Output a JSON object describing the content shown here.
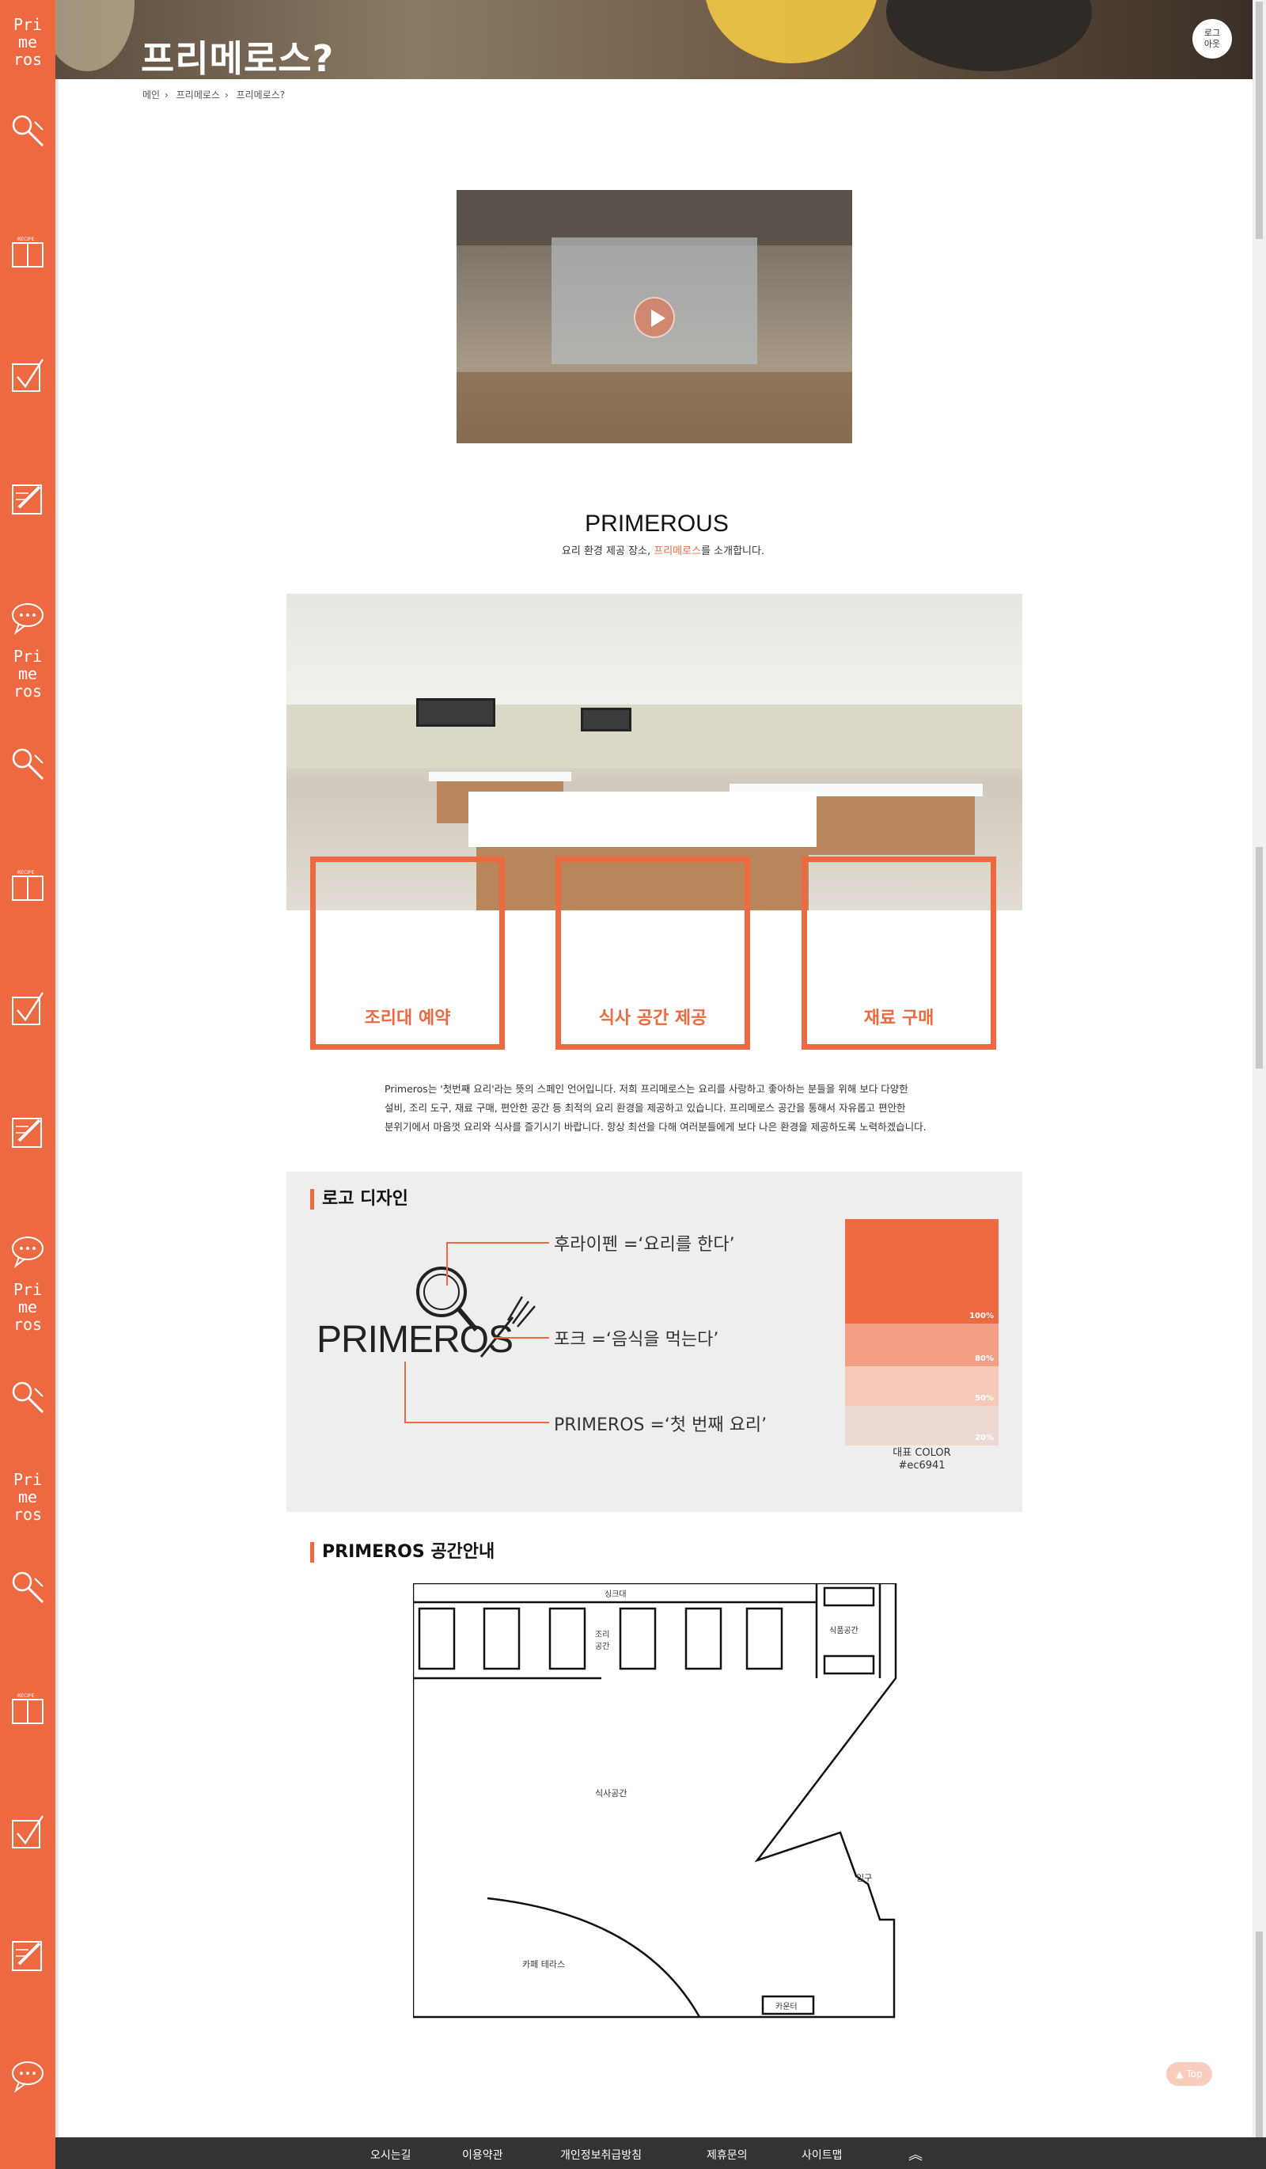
{
  "sidebar": {
    "logo_text": "Pri\nme\nros",
    "recipe_label": "RECIPE"
  },
  "hero": {
    "title": "프리메로스?",
    "logout": "로그\n아웃"
  },
  "breadcrumb": [
    "메인",
    "프리메로스",
    "프리메로스?"
  ],
  "intro_block": {
    "brand": "PRIMEROUS",
    "subtitle_pre": "요리 환경 제공 장소, ",
    "subtitle_highlight": "프리메로스",
    "subtitle_post": "를 소개합니다."
  },
  "features": [
    "조리대 예약",
    "식사 공간 제공",
    "재료 구매"
  ],
  "intro_text": [
    "Primeros는 '첫번째 요리'라는 뜻의 스페인 언어입니다. 저희 프리메로스는 요리를 사랑하고 좋아하는 분들을 위해 보다 다양한",
    "설비, 조리 도구, 재료 구매, 편안한 공간 등 최적의 요리 환경을 제공하고 있습니다. 프리메로스 공간을 통해서 자유롭고 편안한",
    "분위기에서 마음껏 요리와 식사를 즐기시기 바랍니다. 항상 최선을 다해 여러분들에게 보다 나은 환경을 제공하도록 노력하겠습니다."
  ],
  "logo_design": {
    "title": "로고 디자인",
    "wordmark": "PRIMEROS",
    "descs": [
      "후라이펜 =‘요리를 한다’",
      "포크 =‘음식을 먹는다’",
      "PRIMEROS =‘첫 번째 요리’"
    ],
    "swatches": [
      {
        "label": "100%",
        "color": "#ec6941"
      },
      {
        "label": "80%",
        "color": "#f29f86"
      },
      {
        "label": "50%",
        "color": "#f6c8b8"
      },
      {
        "label": "20%",
        "color": "#ecd9d4"
      }
    ],
    "color_caption": "대표 COLOR",
    "color_hex": "#ec6941"
  },
  "space_guide": {
    "title": "PRIMEROS 공간안내",
    "labels": {
      "sink": "싱크대",
      "cooking": "조리\n공간",
      "pantry": "식품공간",
      "dining": "식사공간",
      "entrance": "입구",
      "terrace": "카페 테라스",
      "counter": "카운터"
    }
  },
  "top_button": "▲ Top",
  "footer": {
    "links": [
      "오시는길",
      "이용약관",
      "개인정보취급방침",
      "제휴문의",
      "사이트맵"
    ],
    "up": "︽"
  },
  "colors": {
    "accent": "#ec6941",
    "footer": "#333333"
  }
}
